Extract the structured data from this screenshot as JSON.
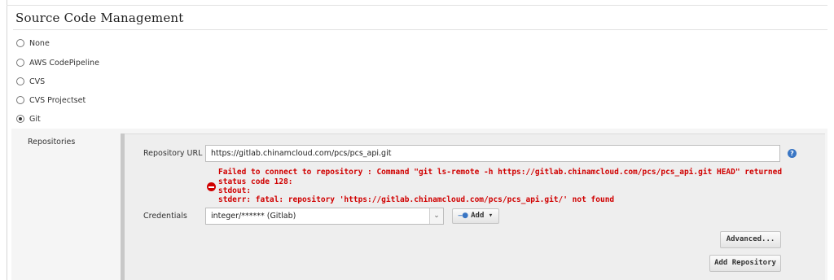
{
  "section": {
    "title": "Source Code Management"
  },
  "scm_options": [
    {
      "label": "None",
      "selected": false
    },
    {
      "label": "AWS CodePipeline",
      "selected": false
    },
    {
      "label": "CVS",
      "selected": false
    },
    {
      "label": "CVS Projectset",
      "selected": false
    },
    {
      "label": "Git",
      "selected": true
    }
  ],
  "repositories": {
    "label": "Repositories",
    "url_label": "Repository URL",
    "url_value": "https://gitlab.chinamcloud.com/pcs/pcs_api.git",
    "error_lines": [
      "Failed to connect to repository : Command \"git ls-remote -h https://gitlab.chinamcloud.com/pcs/pcs_api.git HEAD\" returned",
      "status code 128:",
      "stdout:",
      "stderr: fatal: repository 'https://gitlab.chinamcloud.com/pcs/pcs_api.git/' not found"
    ],
    "credentials_label": "Credentials",
    "credentials_value": "integer/****** (Gitlab)",
    "add_label": "Add",
    "advanced_label": "Advanced...",
    "add_repository_label": "Add Repository"
  },
  "colors": {
    "error": "#d00000",
    "help": "#3a76c4",
    "panel": "#eeeeee"
  },
  "icons": {
    "help": "question-mark-icon",
    "error": "error-minus-icon",
    "key": "key-icon",
    "dropdown": "chevron-down-icon"
  }
}
